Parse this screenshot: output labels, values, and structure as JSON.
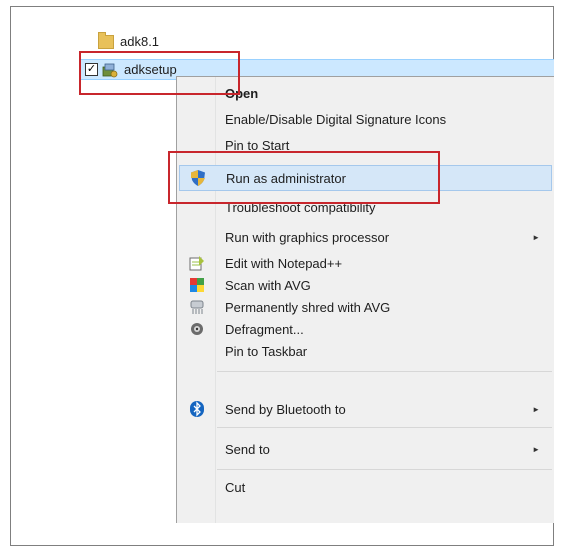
{
  "files": [
    {
      "name": "adk8.1",
      "icon": "folder-icon"
    },
    {
      "name": "adksetup",
      "icon": "setup-icon",
      "checked": true,
      "checkmark": "✓"
    }
  ],
  "menu": {
    "items": [
      {
        "label": "Open",
        "bold": true
      },
      {
        "label": "Enable/Disable Digital Signature Icons"
      },
      {
        "label": "Pin to Start"
      },
      {
        "label": "Run as administrator",
        "icon": "uac-shield-icon",
        "highlighted": true
      },
      {
        "label": "Troubleshoot compatibility"
      },
      {
        "label": "Run with graphics processor",
        "submenu": true
      },
      {
        "label": "Edit with Notepad++",
        "icon": "notepad-plus-plus-icon"
      },
      {
        "label": "Scan with AVG",
        "icon": "avg-icon"
      },
      {
        "label": "Permanently shred with AVG",
        "icon": "shredder-icon"
      },
      {
        "label": "Defragment...",
        "icon": "defrag-icon"
      },
      {
        "label": "Pin to Taskbar"
      },
      {
        "label": "Send by Bluetooth to",
        "icon": "bluetooth-icon",
        "submenu": true
      },
      {
        "label": "Send to",
        "submenu": true
      },
      {
        "label": "Cut"
      }
    ],
    "submenu_arrow": "►"
  },
  "colors": {
    "highlight_box": "#c8262c",
    "selection": "#cce8ff",
    "menu_hover": "#d5e7f8",
    "menu_bg": "#f0f0f0"
  }
}
